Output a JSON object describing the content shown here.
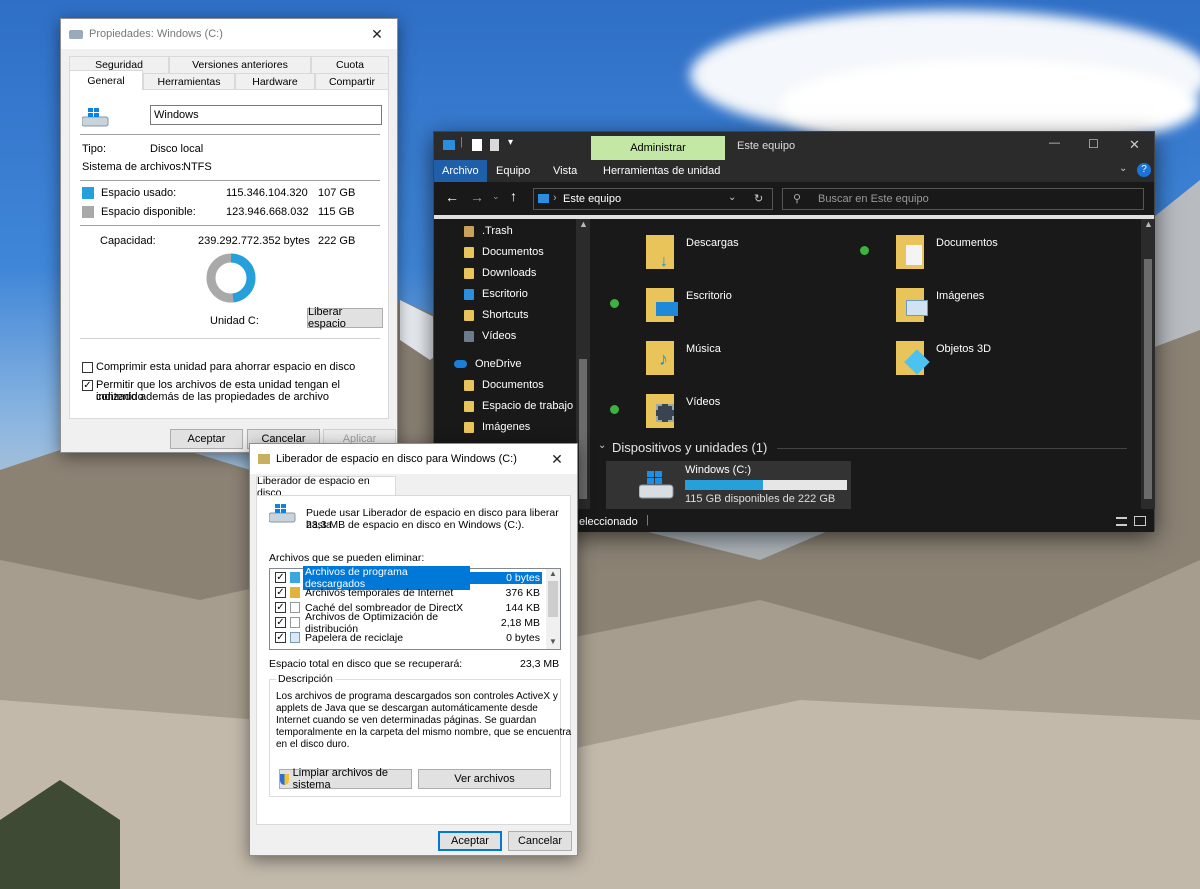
{
  "properties": {
    "title": "Propiedades: Windows (C:)",
    "tabs_row1": [
      "Seguridad",
      "Versiones anteriores",
      "Cuota"
    ],
    "tabs_row2": [
      "General",
      "Herramientas",
      "Hardware",
      "Compartir"
    ],
    "drive_name": "Windows",
    "type_label": "Tipo:",
    "type_value": "Disco local",
    "fs_label": "Sistema de archivos:",
    "fs_value": "NTFS",
    "used_label": "Espacio usado:",
    "used_bytes": "115.346.104.320",
    "used_gb": "107 GB",
    "free_label": "Espacio disponible:",
    "free_bytes": "123.946.668.032",
    "free_gb": "115 GB",
    "cap_label": "Capacidad:",
    "cap_bytes": "239.292.772.352 bytes",
    "cap_gb": "222 GB",
    "used_fraction": 0.482,
    "used_color": "#26a0da",
    "free_color": "#a9a9a9",
    "unit_label": "Unidad C:",
    "free_space_button": "Liberar espacio",
    "compress_label": "Comprimir esta unidad para ahorrar espacio en disco",
    "index_label_1": "Permitir que los archivos de esta unidad tengan el contenido",
    "index_label_2": "indizado además de las propiedades de archivo",
    "ok": "Aceptar",
    "cancel": "Cancelar",
    "apply": "Aplicar"
  },
  "explorer": {
    "manage_tab": "Administrar",
    "title": "Este equipo",
    "ribbon_tabs": [
      "Archivo",
      "Equipo",
      "Vista",
      "Herramientas de unidad"
    ],
    "address": "Este equipo",
    "search_placeholder": "Buscar en Este equipo",
    "nav_items": [
      ".Trash",
      "Documentos",
      "Downloads",
      "Escritorio",
      "Shortcuts",
      "Vídeos"
    ],
    "onedrive": "OneDrive",
    "onedrive_items": [
      "Documentos",
      "Espacio de trabajo",
      "Imágenes"
    ],
    "folders": [
      "Descargas",
      "Documentos",
      "Escritorio",
      "Imágenes",
      "Música",
      "Objetos 3D",
      "Vídeos"
    ],
    "devices_header": "Dispositivos y unidades (1)",
    "drive_label": "Windows (C:)",
    "drive_free": "115 GB disponibles de 222 GB",
    "drive_used_fraction": 0.48,
    "status_text": "eleccionado",
    "accent_color": "#26a0da"
  },
  "cleanup": {
    "title": "Liberador de espacio en disco para Windows (C:)",
    "tab": "Liberador de espacio en disco",
    "intro_1": "Puede usar Liberador de espacio en disco para liberar hasta",
    "intro_2": "23,3 MB de espacio en disco en Windows (C:).",
    "files_label": "Archivos que se pueden eliminar:",
    "files": [
      {
        "name": "Archivos de programa descargados",
        "size": "0 bytes"
      },
      {
        "name": "Archivos temporales de Internet",
        "size": "376 KB"
      },
      {
        "name": "Caché del sombreador de DirectX",
        "size": "144 KB"
      },
      {
        "name": "Archivos de Optimización de distribución",
        "size": "2,18 MB"
      },
      {
        "name": "Papelera de reciclaje",
        "size": "0 bytes"
      }
    ],
    "total_label": "Espacio total en disco que se recuperará:",
    "total_value": "23,3 MB",
    "desc_label": "Descripción",
    "desc_lines": [
      "Los archivos de programa descargados son controles ActiveX y",
      "applets de Java que se descargan automáticamente desde",
      "Internet cuando se ven determinadas páginas. Se guardan",
      "temporalmente en la carpeta del mismo nombre, que se encuentra",
      "en el disco duro."
    ],
    "clean_system": "Limpiar archivos de sistema",
    "view_files": "Ver archivos",
    "ok": "Aceptar",
    "cancel": "Cancelar"
  }
}
